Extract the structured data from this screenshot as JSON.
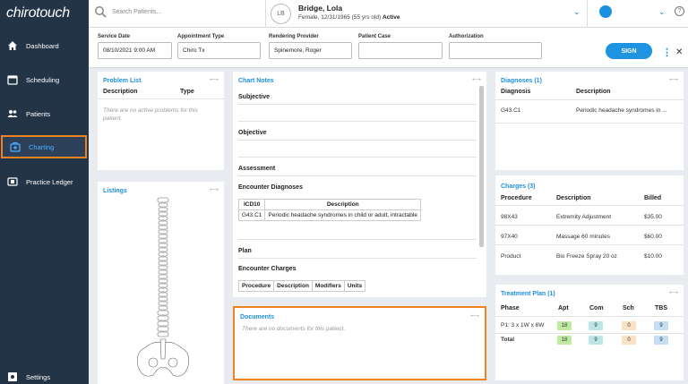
{
  "app": {
    "logo": "chirotouch"
  },
  "sidebar": {
    "items": [
      {
        "label": "Dashboard",
        "icon": "home-icon"
      },
      {
        "label": "Scheduling",
        "icon": "calendar-icon"
      },
      {
        "label": "Patients",
        "icon": "people-icon"
      },
      {
        "label": "Charting",
        "icon": "medical-bag-icon",
        "active": true
      },
      {
        "label": "Practice Ledger",
        "icon": "ledger-icon"
      },
      {
        "label": "Settings",
        "icon": "gear-icon"
      }
    ]
  },
  "topbar": {
    "search_placeholder": "Search Patients...",
    "patient": {
      "initials": "LB",
      "name": "Bridge, Lola",
      "info": "Female, 12/31/1965 (55 yrs old)",
      "status": "Active"
    },
    "help": "?"
  },
  "form": {
    "service_date": {
      "label": "Service Date",
      "value": "08/10/2021 9:00 AM"
    },
    "appointment_type": {
      "label": "Appointment Type",
      "value": "Chiro Tx"
    },
    "rendering_provider": {
      "label": "Rendering Provider",
      "value": "Spinemore, Roger"
    },
    "patient_case": {
      "label": "Patient Case",
      "value": ""
    },
    "authorization": {
      "label": "Authorization",
      "value": ""
    },
    "sign_label": "SIGN"
  },
  "problem_list": {
    "title": "Problem List",
    "columns": [
      "Description",
      "Type"
    ],
    "empty": "There are no active problems for this patient."
  },
  "listings": {
    "title": "Listings"
  },
  "chart_notes": {
    "title": "Chart Notes",
    "subjective": "Subjective",
    "objective": "Objective",
    "assessment": "Assessment",
    "encounter_diagnoses": "Encounter Diagnoses",
    "diag_columns": [
      "ICD10",
      "Description"
    ],
    "diag_rows": [
      {
        "code": "G43.C1",
        "desc": "Periodic headache syndromes in child or adult, intractable"
      }
    ],
    "plan": "Plan",
    "encounter_charges": "Encounter Charges",
    "charge_columns": [
      "Procedure",
      "Description",
      "Modifiers",
      "Units"
    ]
  },
  "documents": {
    "title": "Documents",
    "empty": "There are no documents for this patient."
  },
  "diagnoses": {
    "title": "Diagnoses (1)",
    "columns": [
      "Diagnosis",
      "Description"
    ],
    "rows": [
      {
        "code": "G43.C1",
        "desc": "Periodic headache syndromes in ..."
      }
    ]
  },
  "charges": {
    "title": "Charges (3)",
    "columns": [
      "Procedure",
      "Description",
      "Billed"
    ],
    "rows": [
      {
        "proc": "98X43",
        "desc": "Extremity Adjustment",
        "billed": "$35.00"
      },
      {
        "proc": "97X40",
        "desc": "Massage 60 minutes",
        "billed": "$60.00"
      },
      {
        "proc": "Product",
        "desc": "Bio Freeze Spray 20 oz",
        "billed": "$10.00"
      }
    ]
  },
  "treatment_plan": {
    "title": "Treatment Plan (1)",
    "columns": [
      "Phase",
      "Apt",
      "Com",
      "Sch",
      "TBS"
    ],
    "rows": [
      {
        "phase": "P1: 3 x 1W x 6W",
        "apt": "18",
        "com": "9",
        "sch": "0",
        "tbs": "9"
      },
      {
        "phase": "Total",
        "apt": "18",
        "com": "9",
        "sch": "0",
        "tbs": "9"
      }
    ]
  },
  "colors": {
    "sidebar_bg": "#233447",
    "accent": "#1e8fdc",
    "highlight": "#f0831f"
  }
}
